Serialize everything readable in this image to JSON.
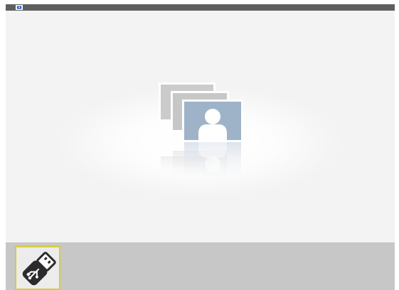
{
  "top_bar": {
    "icon": "media-source-icon"
  },
  "viewer": {
    "illustration": "photo-stack-icon"
  },
  "dock": {
    "items": [
      {
        "icon": "usb-drive-icon",
        "selected": true
      }
    ]
  },
  "colors": {
    "top_bar": "#5f5f5f",
    "viewer_background": "#f3f3f3",
    "dock_background": "#c7c7c7",
    "selection": "#d7cc3c"
  }
}
